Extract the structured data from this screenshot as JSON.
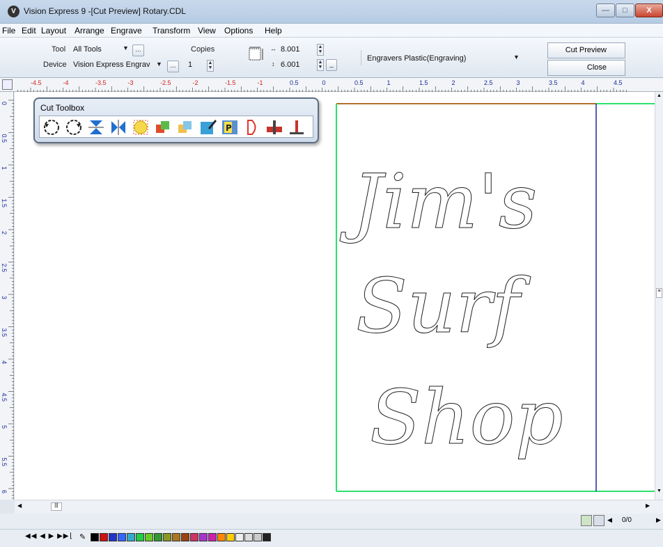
{
  "window": {
    "title": "Vision Express 9 -[Cut Preview] Rotary.CDL",
    "minimize_label": "—",
    "maximize_label": "□",
    "close_label": "X"
  },
  "menu": [
    "File",
    "Edit",
    "Layout",
    "Arrange",
    "Engrave",
    "Transform",
    "View",
    "Options",
    "Help"
  ],
  "toolbar": {
    "tool_label": "Tool",
    "tool_value": "All Tools",
    "device_label": "Device",
    "device_value": "Vision Express Engrav",
    "copies_label": "Copies",
    "copies_value": "1",
    "width_value": "8.001",
    "height_value": "6.001",
    "material_value": "Engravers Plastic(Engraving)",
    "cut_preview_label": "Cut Preview",
    "close_label": "Close"
  },
  "ruler": {
    "top_labels": [
      "-4.5",
      "-4",
      "-3.5",
      "-3",
      "-2.5",
      "-2",
      "-1.5",
      "-1",
      "0.5",
      "0",
      "0.5",
      "1",
      "1.5",
      "2",
      "2.5",
      "3",
      "3.5",
      "4",
      "4.5"
    ],
    "left_labels": [
      "0",
      "0.5",
      "1",
      "1.5",
      "2",
      "2.5",
      "3",
      "3.5",
      "4",
      "4.5",
      "5",
      "5.5",
      "6"
    ]
  },
  "toolbox": {
    "title": "Cut Toolbox",
    "icons": [
      "rotate-ccw-icon",
      "rotate-cw-icon",
      "flip-vertical-icon",
      "flip-horizontal-icon",
      "circle-select-icon",
      "weld-icon",
      "group-icon",
      "edit-path-icon",
      "pattern-icon",
      "d-shape-icon",
      "cutter-icon",
      "t-tool-icon"
    ]
  },
  "canvas_text": {
    "line1": "Jim's",
    "line2": "Surf",
    "line3": "Shop"
  },
  "status": {
    "page_count": "0/0"
  },
  "colors": {
    "page_border": "#2be06e",
    "cut_line_blue": "#1a2a9c",
    "top_edge": "#b0702a",
    "ruler_neg": "#cc2222"
  },
  "palette": [
    "#000000",
    "#cc1111",
    "#2233cc",
    "#3366ff",
    "#33aacc",
    "#22cc44",
    "#66cc22",
    "#339933",
    "#889922",
    "#aa7722",
    "#994411",
    "#cc3366",
    "#aa33cc",
    "#cc22aa",
    "#ff8800",
    "#ffcc00",
    "#eeeeee",
    "#dddddd",
    "#cccccc",
    "#222222"
  ]
}
